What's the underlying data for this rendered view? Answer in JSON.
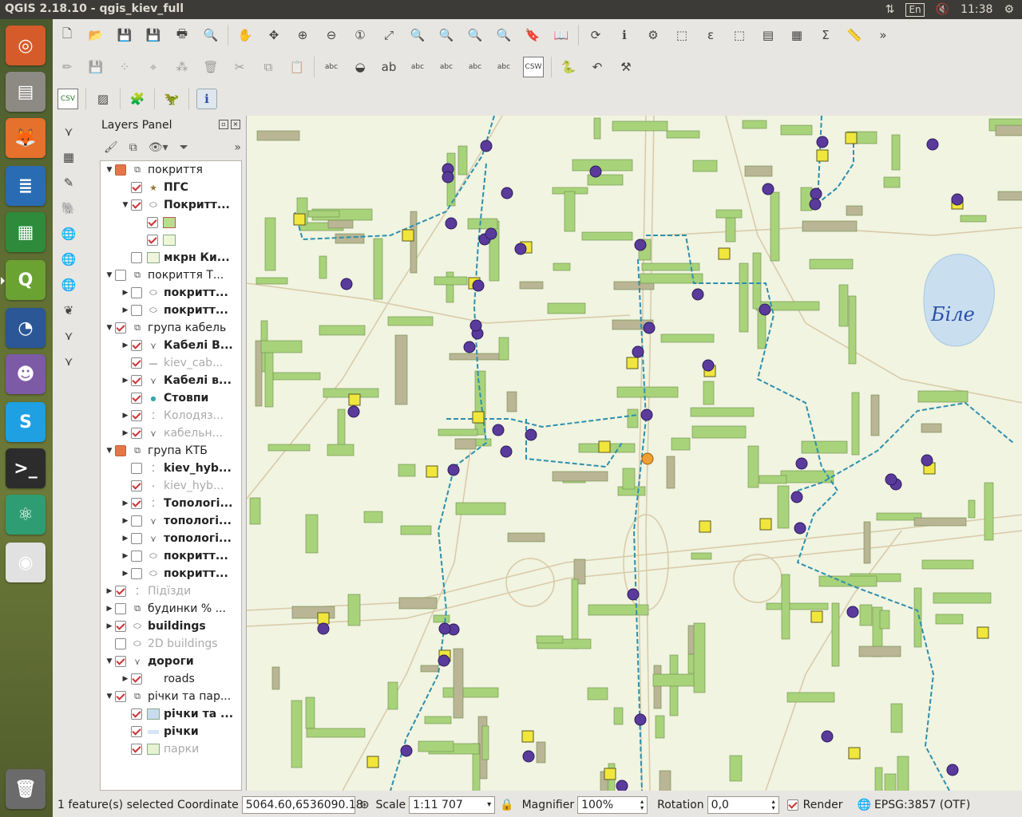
{
  "window": {
    "title": "QGIS 2.18.10 - qgis_kiev_full",
    "keyboard_layout": "En",
    "clock": "11:38"
  },
  "launcher": {
    "apps": [
      {
        "name": "ubuntu-dash",
        "color": "#d65b2a",
        "glyph": "◎"
      },
      {
        "name": "files",
        "color": "#8d8a84",
        "glyph": "▤"
      },
      {
        "name": "firefox",
        "color": "#e5712c",
        "glyph": "🦊"
      },
      {
        "name": "writer",
        "color": "#2a6cb3",
        "glyph": "≣"
      },
      {
        "name": "calc",
        "color": "#2e8b3c",
        "glyph": "▦"
      },
      {
        "name": "qgis",
        "color": "#6aa332",
        "glyph": "Q"
      },
      {
        "name": "thunderbird",
        "color": "#2b5797",
        "glyph": "◔"
      },
      {
        "name": "pidgin",
        "color": "#7d5aa6",
        "glyph": "☻"
      },
      {
        "name": "skype",
        "color": "#1ea0e3",
        "glyph": "S"
      },
      {
        "name": "terminal",
        "color": "#2c2c2c",
        "glyph": ">_"
      },
      {
        "name": "atom",
        "color": "#2f9d73",
        "glyph": "⚛"
      },
      {
        "name": "chrome",
        "color": "#e1e1e1",
        "glyph": "◉"
      },
      {
        "name": "trash",
        "color": "#6b6b6b",
        "glyph": "🗑"
      }
    ]
  },
  "toolbar": {
    "row1_icons": [
      "new-project-icon",
      "open-project-icon",
      "save-project-icon",
      "save-as-icon",
      "new-print-composer-icon",
      "composer-manager-icon",
      "pan-icon",
      "pan-to-selection-icon",
      "zoom-in-icon",
      "zoom-out-icon",
      "zoom-native-icon",
      "zoom-full-icon",
      "zoom-to-selection-icon",
      "zoom-to-layer-icon",
      "zoom-last-icon",
      "zoom-next-icon",
      "new-bookmark-icon",
      "show-bookmarks-icon",
      "refresh-icon",
      "identify-icon",
      "measure-icon",
      "select-features-icon",
      "select-by-expression-icon",
      "deselect-icon",
      "attribute-table-icon",
      "field-calculator-icon",
      "statistics-sum-icon",
      "measure-line-icon"
    ],
    "row2_icons": [
      "toggle-editing-icon",
      "save-edits-icon",
      "add-feature-icon",
      "move-feature-icon",
      "node-tool-icon",
      "delete-selected-icon",
      "cut-icon",
      "copy-icon",
      "paste-icon",
      "label-tool-icon",
      "label-pin-icon",
      "label-highlight-icon",
      "label-show-hide-icon",
      "label-move-icon",
      "label-rotate-icon",
      "label-change-icon",
      "csw-icon",
      "python-console-icon",
      "undo-icon",
      "processing-icon"
    ],
    "row3_icons": [
      "csv-icon",
      "hatching-icon",
      "plugin-icon",
      "dino-plugin-icon",
      "info-icon"
    ],
    "csw_label": "CSW",
    "csv_label": "CSV"
  },
  "layers_panel": {
    "title": "Layers Panel",
    "layers": [
      {
        "label": "покриття",
        "arrow": "▼",
        "checked": "part",
        "kind": "group",
        "indent": 0,
        "bold": false,
        "grey": false
      },
      {
        "label": "ПГС",
        "arrow": "",
        "checked": "on",
        "kind": "star",
        "indent": 1,
        "bold": true,
        "grey": false
      },
      {
        "label": "Покритт...",
        "arrow": "▼",
        "checked": "on",
        "kind": "polygon",
        "indent": 1,
        "bold": true,
        "grey": false
      },
      {
        "label": "",
        "arrow": "",
        "checked": "on",
        "kind": "swatch-green",
        "indent": 2,
        "bold": false,
        "grey": false
      },
      {
        "label": "",
        "arrow": "",
        "checked": "on",
        "kind": "swatch-light",
        "indent": 2,
        "bold": false,
        "grey": false
      },
      {
        "label": "мкрн Ки...",
        "arrow": "",
        "checked": "off",
        "kind": "swatch-pale",
        "indent": 1,
        "bold": true,
        "grey": false
      },
      {
        "label": "покриття Т...",
        "arrow": "▼",
        "checked": "off",
        "kind": "group",
        "indent": 0,
        "bold": false,
        "grey": false
      },
      {
        "label": "покритт...",
        "arrow": "▶",
        "checked": "off",
        "kind": "polygon",
        "indent": 1,
        "bold": true,
        "grey": false
      },
      {
        "label": "покритт...",
        "arrow": "▶",
        "checked": "off",
        "kind": "polygon",
        "indent": 1,
        "bold": true,
        "grey": false
      },
      {
        "label": "група кабель",
        "arrow": "▼",
        "checked": "on",
        "kind": "group",
        "indent": 0,
        "bold": false,
        "grey": false
      },
      {
        "label": "Кабелі В...",
        "arrow": "▶",
        "checked": "on",
        "kind": "line",
        "indent": 1,
        "bold": true,
        "grey": false
      },
      {
        "label": "kiev_cab...",
        "arrow": "",
        "checked": "on",
        "kind": "line-thin",
        "indent": 1,
        "bold": false,
        "grey": true
      },
      {
        "label": "Кабелі в...",
        "arrow": "▶",
        "checked": "on",
        "kind": "line",
        "indent": 1,
        "bold": true,
        "grey": false
      },
      {
        "label": "Стовпи",
        "arrow": "",
        "checked": "on",
        "kind": "dot",
        "indent": 1,
        "bold": true,
        "grey": false
      },
      {
        "label": "Колодяз...",
        "arrow": "▶",
        "checked": "on",
        "kind": "points",
        "indent": 1,
        "bold": false,
        "grey": true
      },
      {
        "label": "кабельн...",
        "arrow": "▶",
        "checked": "on",
        "kind": "line",
        "indent": 1,
        "bold": false,
        "grey": true
      },
      {
        "label": "група КТБ",
        "arrow": "▼",
        "checked": "part",
        "kind": "group",
        "indent": 0,
        "bold": false,
        "grey": false
      },
      {
        "label": "kiev_hyb...",
        "arrow": "",
        "checked": "off",
        "kind": "points",
        "indent": 1,
        "bold": true,
        "grey": false
      },
      {
        "label": "kiev_hyb...",
        "arrow": "",
        "checked": "on",
        "kind": "point-small",
        "indent": 1,
        "bold": false,
        "grey": true
      },
      {
        "label": "Топологі...",
        "arrow": "▶",
        "checked": "on",
        "kind": "points",
        "indent": 1,
        "bold": true,
        "grey": false
      },
      {
        "label": "топологі...",
        "arrow": "▶",
        "checked": "off",
        "kind": "line",
        "indent": 1,
        "bold": true,
        "grey": false
      },
      {
        "label": "топологі...",
        "arrow": "▶",
        "checked": "off",
        "kind": "line",
        "indent": 1,
        "bold": true,
        "grey": false
      },
      {
        "label": "покритт...",
        "arrow": "▶",
        "checked": "off",
        "kind": "polygon",
        "indent": 1,
        "bold": true,
        "grey": false
      },
      {
        "label": "покритт...",
        "arrow": "▶",
        "checked": "off",
        "kind": "polygon",
        "indent": 1,
        "bold": true,
        "grey": false
      },
      {
        "label": "Підїзди",
        "arrow": "▶",
        "checked": "on",
        "kind": "points",
        "indent": 0,
        "bold": false,
        "grey": true
      },
      {
        "label": "будинки % ...",
        "arrow": "▶",
        "checked": "off",
        "kind": "group",
        "indent": 0,
        "bold": false,
        "grey": false
      },
      {
        "label": "buildings",
        "arrow": "▶",
        "checked": "on",
        "kind": "polygon",
        "indent": 0,
        "bold": true,
        "grey": false
      },
      {
        "label": "2D buildings",
        "arrow": "",
        "checked": "off",
        "kind": "polygon",
        "indent": 0,
        "bold": false,
        "grey": true
      },
      {
        "label": "дороги",
        "arrow": "▼",
        "checked": "on",
        "kind": "line",
        "indent": 0,
        "bold": true,
        "grey": false
      },
      {
        "label": "roads",
        "arrow": "▶",
        "checked": "on",
        "kind": "none",
        "indent": 1,
        "bold": false,
        "grey": false
      },
      {
        "label": "річки та пар...",
        "arrow": "▼",
        "checked": "on",
        "kind": "group",
        "indent": 0,
        "bold": false,
        "grey": false
      },
      {
        "label": "річки та ...",
        "arrow": "",
        "checked": "on",
        "kind": "swatch-blue",
        "indent": 1,
        "bold": true,
        "grey": false
      },
      {
        "label": "річки",
        "arrow": "",
        "checked": "on",
        "kind": "swatch-blue-thin",
        "indent": 1,
        "bold": true,
        "grey": false
      },
      {
        "label": "парки",
        "arrow": "",
        "checked": "on",
        "kind": "swatch-park",
        "indent": 1,
        "bold": false,
        "grey": true
      }
    ]
  },
  "map": {
    "lake_label": "Біле",
    "colors": {
      "background": "#f0f4e0",
      "building_green": "#a8d37a",
      "building_grey": "#b9b595",
      "pole_purple": "#5a3b9c",
      "node_yellow": "#f1e63c",
      "cable_blue": "#2e8fae",
      "lake": "#c9dff0",
      "road": "#d9c9a8"
    }
  },
  "status": {
    "selection": "1 feature(s) selected c",
    "coordinate_label": "Coordinate",
    "coordinate_value": "5064.60,6536090.18",
    "scale_label": "Scale",
    "scale_value": "1:11 707",
    "magnifier_label": "Magnifier",
    "magnifier_value": "100%",
    "rotation_label": "Rotation",
    "rotation_value": "0,0",
    "render_label": "Render",
    "crs": "EPSG:3857 (OTF)"
  }
}
